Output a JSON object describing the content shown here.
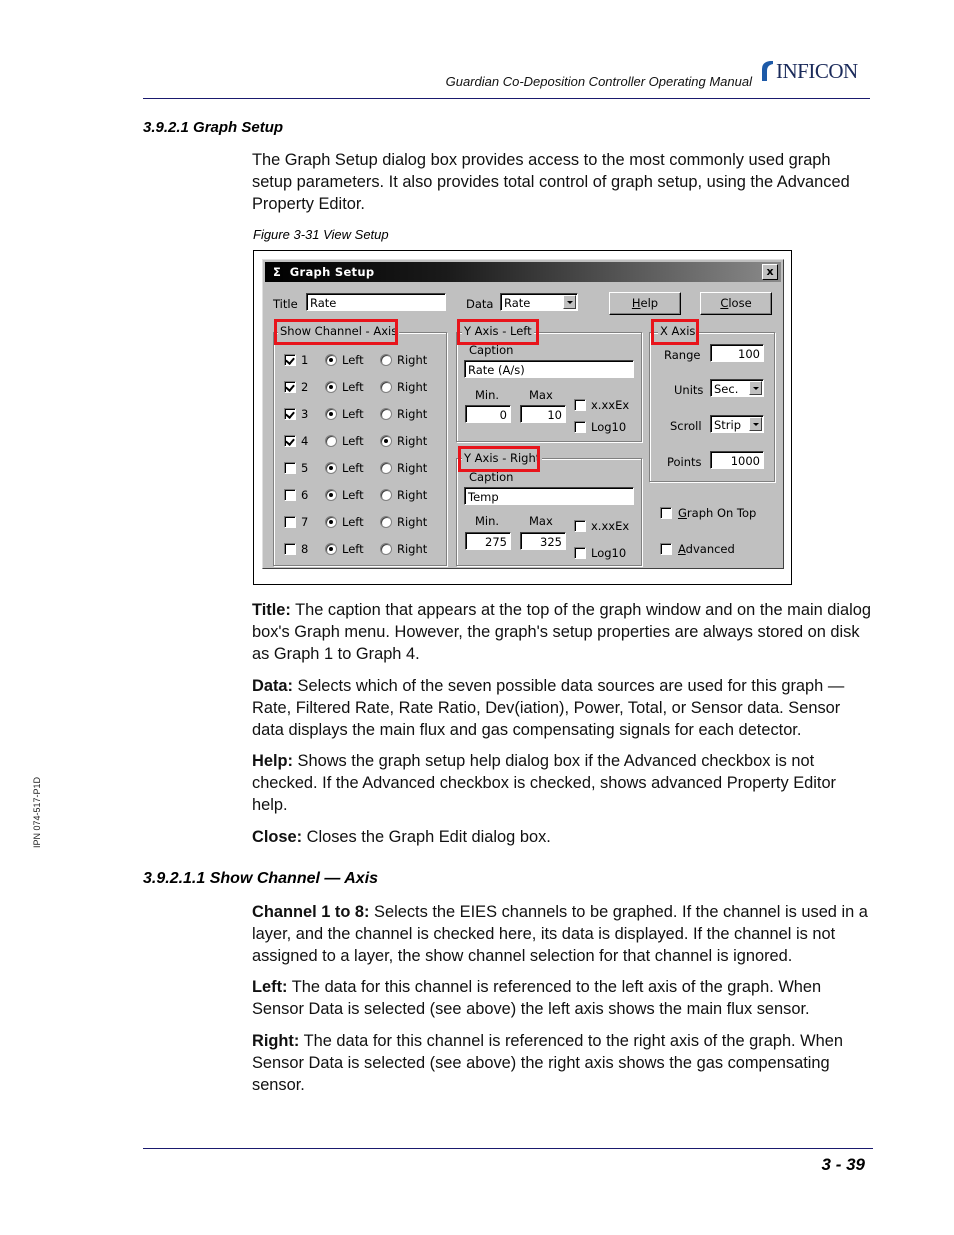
{
  "header": {
    "manual_title": "Guardian Co-Deposition Controller Operating Manual",
    "logo_text": "INFICON"
  },
  "section": {
    "heading": "3.9.2.1  Graph Setup",
    "intro": "The Graph Setup dialog box provides access to the most commonly used graph setup parameters. It also provides total control of graph setup, using the Advanced Property Editor.",
    "figure_caption": "Figure 3-31  View Setup"
  },
  "dialog": {
    "title": "Graph Setup",
    "title_icon": "sigma-icon",
    "close_label": "x",
    "title_label": "Title",
    "title_value": "Rate",
    "data_label": "Data",
    "data_value": "Rate",
    "help_button": "Help",
    "close_button": "Close",
    "show_channel": {
      "group_title": "Show Channel - Axis",
      "left_label": "Left",
      "right_label": "Right",
      "channels": [
        {
          "num": "1",
          "checked": true,
          "axis": "Left"
        },
        {
          "num": "2",
          "checked": true,
          "axis": "Left"
        },
        {
          "num": "3",
          "checked": true,
          "axis": "Left"
        },
        {
          "num": "4",
          "checked": true,
          "axis": "Right"
        },
        {
          "num": "5",
          "checked": false,
          "axis": "Left"
        },
        {
          "num": "6",
          "checked": false,
          "axis": "Left"
        },
        {
          "num": "7",
          "checked": false,
          "axis": "Left"
        },
        {
          "num": "8",
          "checked": false,
          "axis": "Left"
        }
      ]
    },
    "y_left": {
      "group_title": "Y Axis - Left",
      "caption_label": "Caption",
      "caption_value": "Rate (A/s)",
      "min_label": "Min.",
      "max_label": "Max",
      "min_value": "0",
      "max_value": "10",
      "exp_label": "x.xxEx",
      "log_label": "Log10",
      "exp_checked": false,
      "log_checked": false
    },
    "y_right": {
      "group_title": "Y Axis - Right",
      "caption_label": "Caption",
      "caption_value": "Temp",
      "min_label": "Min.",
      "max_label": "Max",
      "min_value": "275",
      "max_value": "325",
      "exp_label": "x.xxEx",
      "log_label": "Log10",
      "exp_checked": false,
      "log_checked": false
    },
    "x_axis": {
      "group_title": "X Axis",
      "range_label": "Range",
      "range_value": "100",
      "units_label": "Units",
      "units_value": "Sec.",
      "scroll_label": "Scroll",
      "scroll_value": "Strip",
      "points_label": "Points",
      "points_value": "1000"
    },
    "graph_on_top_label": "Graph On Top",
    "advanced_label": "Advanced",
    "graph_on_top_checked": false,
    "advanced_checked": false,
    "highlight_color": "#e8141b"
  },
  "descriptions": [
    {
      "term": "Title:",
      "text": " The caption that appears at the top of the graph window and on the main dialog box's Graph menu. However, the graph's setup properties are always stored on disk as Graph 1 to Graph 4."
    },
    {
      "term": "Data:",
      "text": " Selects which of the seven possible data sources are used for this graph — Rate, Filtered Rate, Rate Ratio, Dev(iation), Power, Total, or Sensor data. Sensor data displays the main flux and gas compensating signals for each detector."
    },
    {
      "term": "Help:",
      "text": " Shows the graph setup help dialog box if the Advanced checkbox is not checked. If the Advanced checkbox is checked, shows advanced Property Editor help."
    },
    {
      "term": "Close:",
      "text": " Closes the Graph Edit dialog box."
    }
  ],
  "subsection": {
    "heading": "3.9.2.1.1  Show Channel — Axis",
    "items": [
      {
        "term": "Channel 1 to 8:",
        "text": " Selects the EIES channels to be graphed. If the channel is used in a layer, and the channel is checked here, its data is displayed. If the channel is not assigned to a layer, the show channel selection for that channel is ignored."
      },
      {
        "term": "Left:",
        "text": " The data for this channel is referenced to the left axis of the graph. When Sensor Data is selected (see above) the left axis shows the main flux sensor."
      },
      {
        "term": "Right:",
        "text": " The data for this channel is referenced to the right axis of the graph. When Sensor Data is selected (see above) the right axis shows the gas compensating sensor."
      }
    ]
  },
  "side_label": "IPN 074-517-P1D",
  "footer": {
    "page_number": "3 - 39"
  }
}
